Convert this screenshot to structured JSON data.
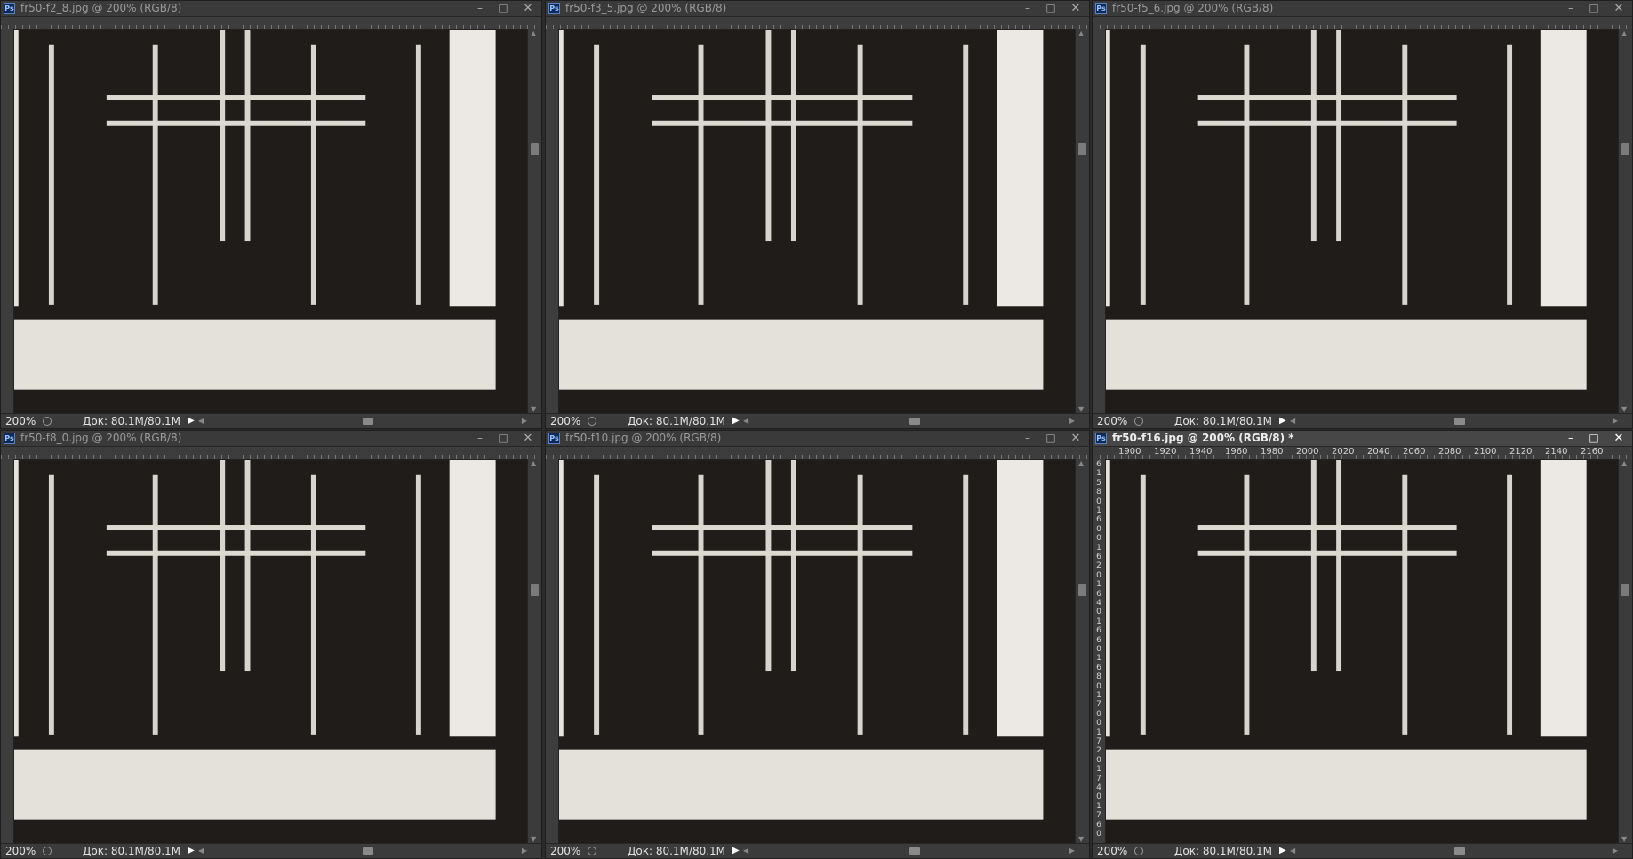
{
  "windows": [
    {
      "title": "fr50-f2_8.jpg @ 200% (RGB/8)",
      "zoom": "200%",
      "doc_size": "Док: 80.1M/80.1M",
      "active": false
    },
    {
      "title": "fr50-f3_5.jpg @ 200% (RGB/8)",
      "zoom": "200%",
      "doc_size": "Док: 80.1M/80.1M",
      "active": false
    },
    {
      "title": "fr50-f5_6.jpg @ 200% (RGB/8)",
      "zoom": "200%",
      "doc_size": "Док: 80.1M/80.1M",
      "active": false
    },
    {
      "title": "fr50-f8_0.jpg @ 200% (RGB/8)",
      "zoom": "200%",
      "doc_size": "Док: 80.1M/80.1M",
      "active": false
    },
    {
      "title": "fr50-f10.jpg @ 200% (RGB/8)",
      "zoom": "200%",
      "doc_size": "Док: 80.1M/80.1M",
      "active": false
    },
    {
      "title": "fr50-f16.jpg @ 200% (RGB/8) *",
      "zoom": "200%",
      "doc_size": "Док: 80.1M/80.1M",
      "active": true,
      "ruler_labels": [
        "1900",
        "1920",
        "1940",
        "1960",
        "1980",
        "2000",
        "2020",
        "2040",
        "2060",
        "2080",
        "2100",
        "2120",
        "2140",
        "2160"
      ],
      "vertical_ruler_digits": [
        "6",
        "1",
        "5",
        "8",
        "0",
        "1",
        "6",
        "0",
        "0",
        "1",
        "6",
        "2",
        "0",
        "1",
        "6",
        "4",
        "0",
        "1",
        "6",
        "6",
        "0",
        "1",
        "6",
        "8",
        "0",
        "1",
        "7",
        "0",
        "0",
        "1",
        "7",
        "2",
        "0",
        "1",
        "7",
        "4",
        "0",
        "1",
        "7",
        "6",
        "0"
      ]
    }
  ],
  "window_controls": {
    "minimize": "–",
    "maximize": "□",
    "close": "✕"
  },
  "icons": {
    "app": "photoshop-doc-icon",
    "status_nav": "status-navigate-icon",
    "status_menu": "status-menu-arrow-icon"
  },
  "colors": {
    "canvas_dark": "#201c19",
    "target_white": "#e8e4df",
    "line_light": "#d9d5cf"
  }
}
